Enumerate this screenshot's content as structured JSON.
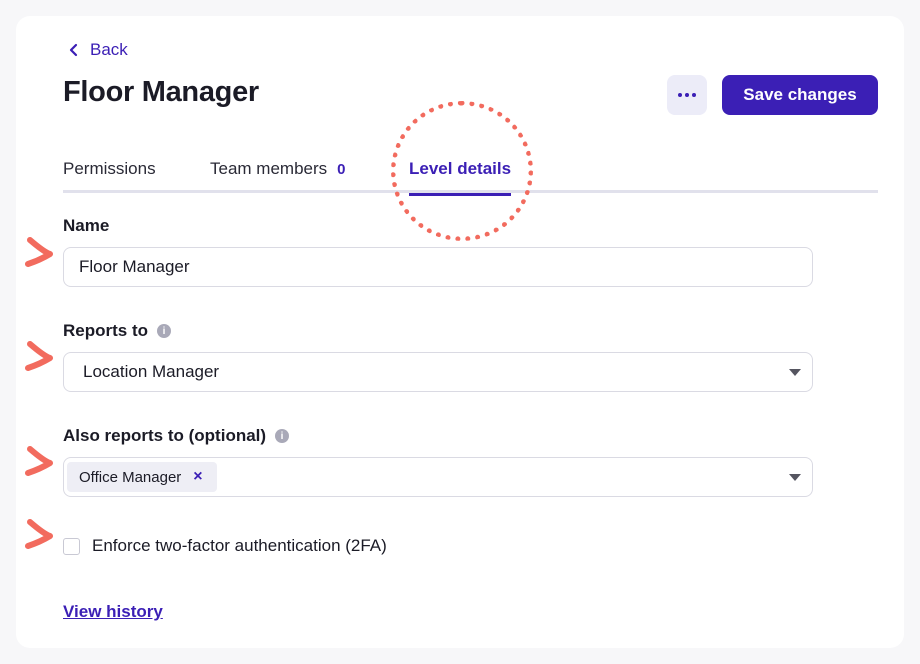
{
  "back": {
    "label": "Back"
  },
  "page": {
    "title": "Floor Manager"
  },
  "actions": {
    "more_icon": "ellipsis-icon",
    "save_label": "Save changes"
  },
  "tabs": [
    {
      "label": "Permissions",
      "active": false
    },
    {
      "label": "Team members",
      "count": "0",
      "active": false
    },
    {
      "label": "Level details",
      "active": true
    }
  ],
  "form": {
    "name": {
      "label": "Name",
      "value": "Floor Manager"
    },
    "reports_to": {
      "label": "Reports to",
      "value": "Location Manager",
      "info_icon": "info-icon"
    },
    "also_reports_to": {
      "label": "Also reports to (optional)",
      "info_icon": "info-icon",
      "chips": [
        {
          "label": "Office Manager",
          "remove_icon": "close-icon"
        }
      ]
    },
    "enforce_2fa": {
      "label": "Enforce two-factor authentication (2FA)",
      "checked": false
    }
  },
  "footer": {
    "history_link": "View history"
  },
  "colors": {
    "accent": "#3b1fb5",
    "annotation": "#f26b5e",
    "tab_underline": "#e1e1ec"
  }
}
